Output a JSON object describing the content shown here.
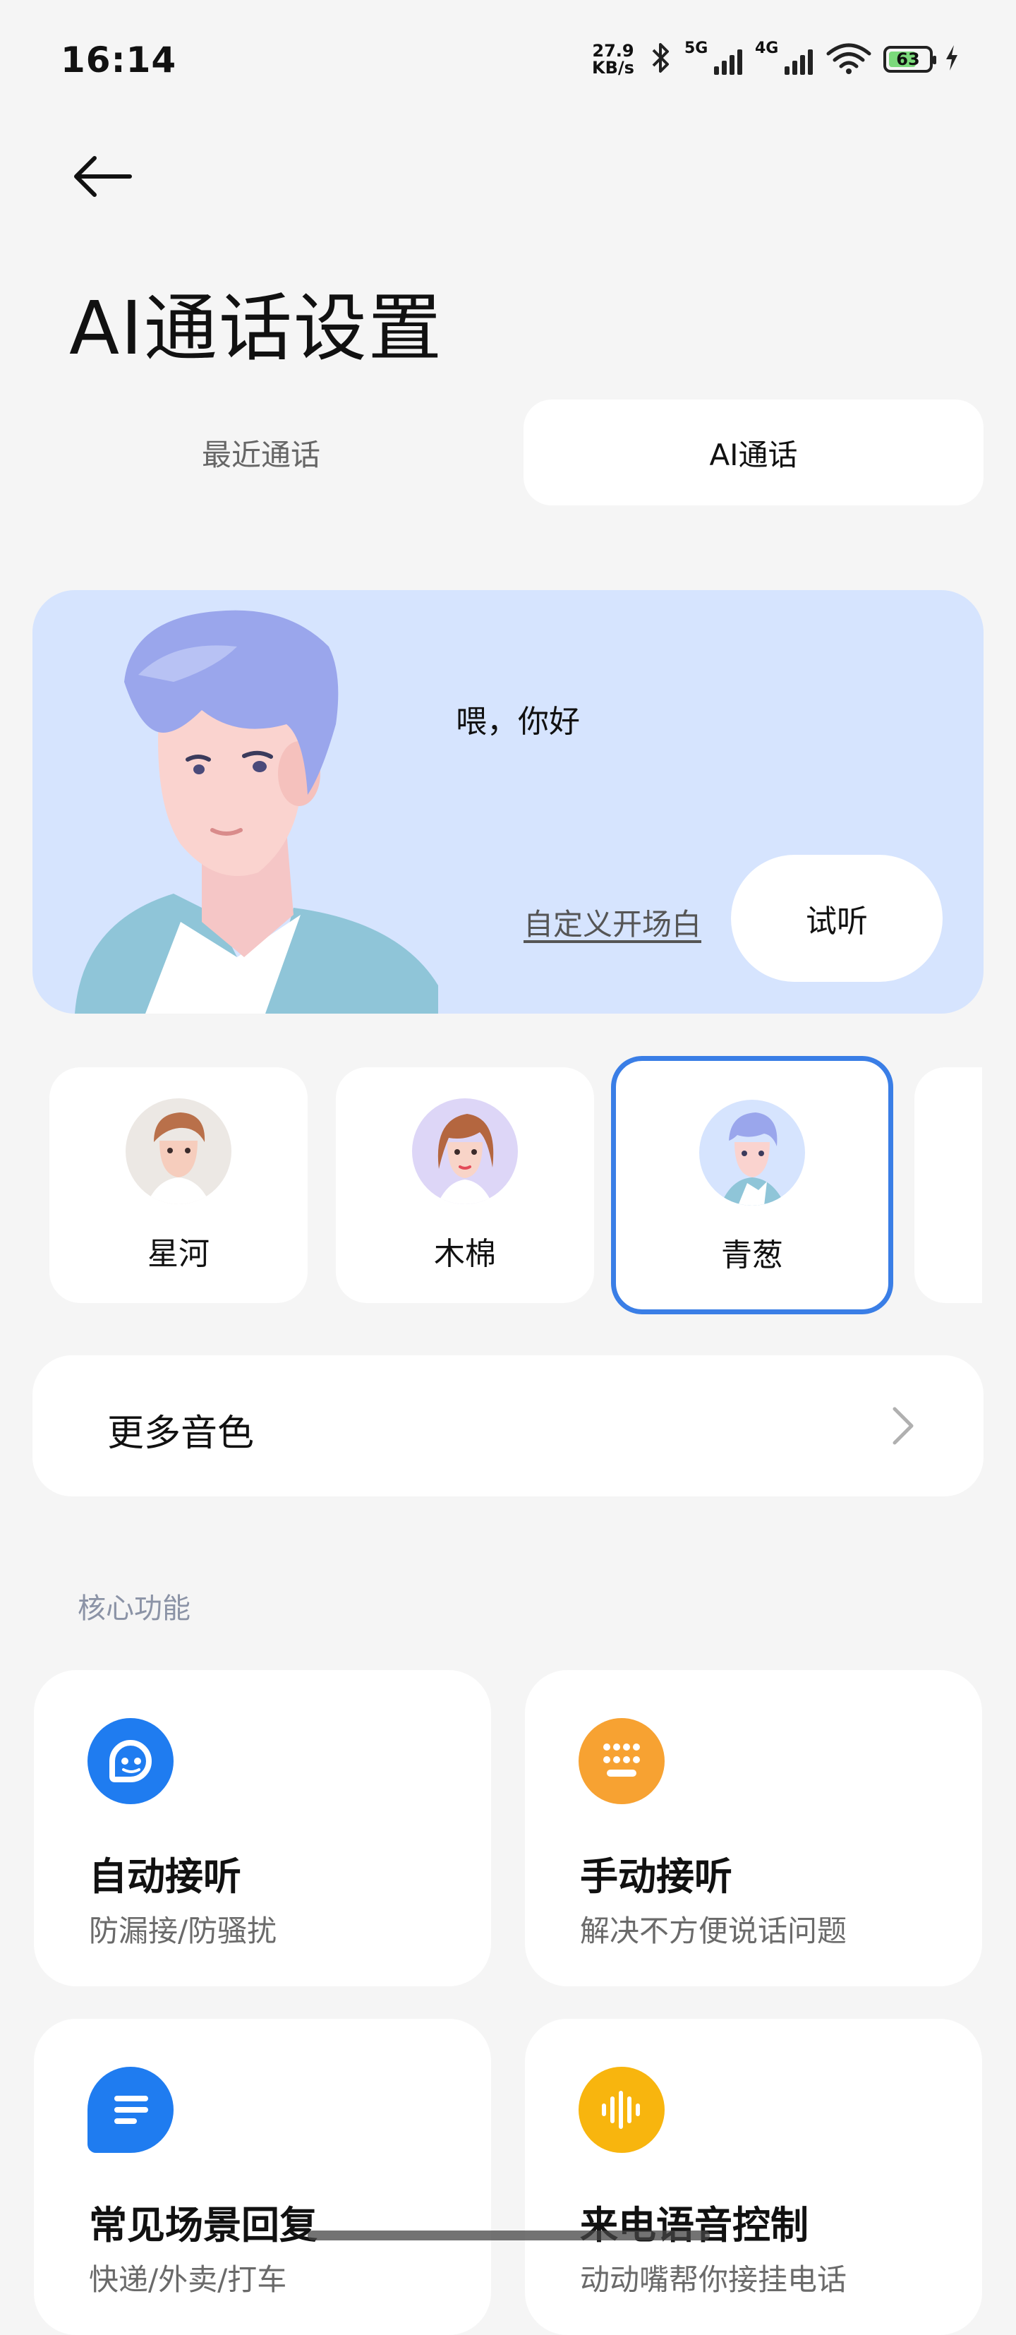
{
  "status_bar": {
    "time": "16:14",
    "net_speed_value": "27.9",
    "net_speed_unit": "KB/s",
    "signal1_label": "5G",
    "signal2_label": "4G",
    "battery": "63"
  },
  "header": {
    "title": "AI通话设置"
  },
  "tabs": [
    {
      "label": "最近通话",
      "selected": false
    },
    {
      "label": "AI通话",
      "selected": true
    }
  ],
  "hero": {
    "greeting": "喂，你好",
    "custom_link": "自定义开场白",
    "try_button": "试听"
  },
  "voices": [
    {
      "name": "星河",
      "selected": false
    },
    {
      "name": "木棉",
      "selected": false
    },
    {
      "name": "青葱",
      "selected": true
    }
  ],
  "more_voices": {
    "label": "更多音色"
  },
  "core_section": {
    "label": "核心功能",
    "features": [
      {
        "title": "自动接听",
        "subtitle": "防漏接/防骚扰",
        "icon": "ai-face-icon",
        "color": "#1f7cf0"
      },
      {
        "title": "手动接听",
        "subtitle": "解决不方便说话问题",
        "icon": "keypad-icon",
        "color": "#f7a232"
      },
      {
        "title": "常见场景回复",
        "subtitle": "快递/外卖/打车",
        "icon": "chat-lines-icon",
        "color": "#1f7cf0"
      },
      {
        "title": "来电语音控制",
        "subtitle": "动动嘴帮你接挂电话",
        "icon": "voice-wave-icon",
        "color": "#f8b50e"
      }
    ]
  }
}
